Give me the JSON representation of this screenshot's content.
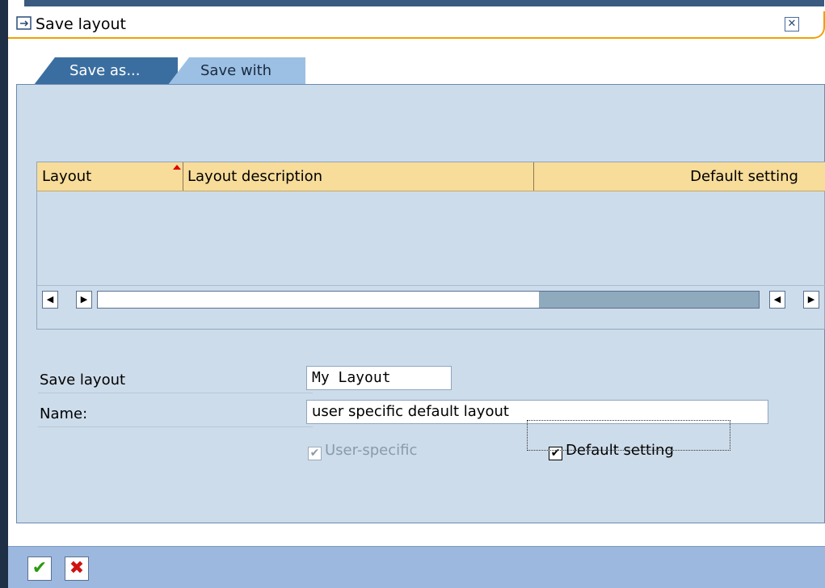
{
  "dialog": {
    "title": "Save layout",
    "close_icon": "close-icon"
  },
  "tabs": [
    {
      "label": "Save as...",
      "active": true
    },
    {
      "label": "Save with",
      "active": false
    }
  ],
  "table": {
    "columns": [
      "Layout",
      "Layout description",
      "Default setting"
    ],
    "rows": []
  },
  "form": {
    "save_layout_label": "Save layout",
    "save_layout_value": "My Layout",
    "name_label": "Name:",
    "name_value": "user specific default layout",
    "user_specific_label": "User-specific",
    "user_specific_checked": true,
    "user_specific_enabled": false,
    "default_setting_label": "Default setting",
    "default_setting_checked": true
  },
  "footer": {
    "ok_icon": "checkmark-icon",
    "cancel_icon": "cancel-x-icon"
  },
  "colors": {
    "accent_orange": "#f0a000",
    "tab_active": "#3b6ea0",
    "tab_inactive": "#9cc0e4",
    "panel_bg": "#cddcea",
    "header_bg": "#f7dc9a",
    "footer_bg": "#9db8de"
  }
}
